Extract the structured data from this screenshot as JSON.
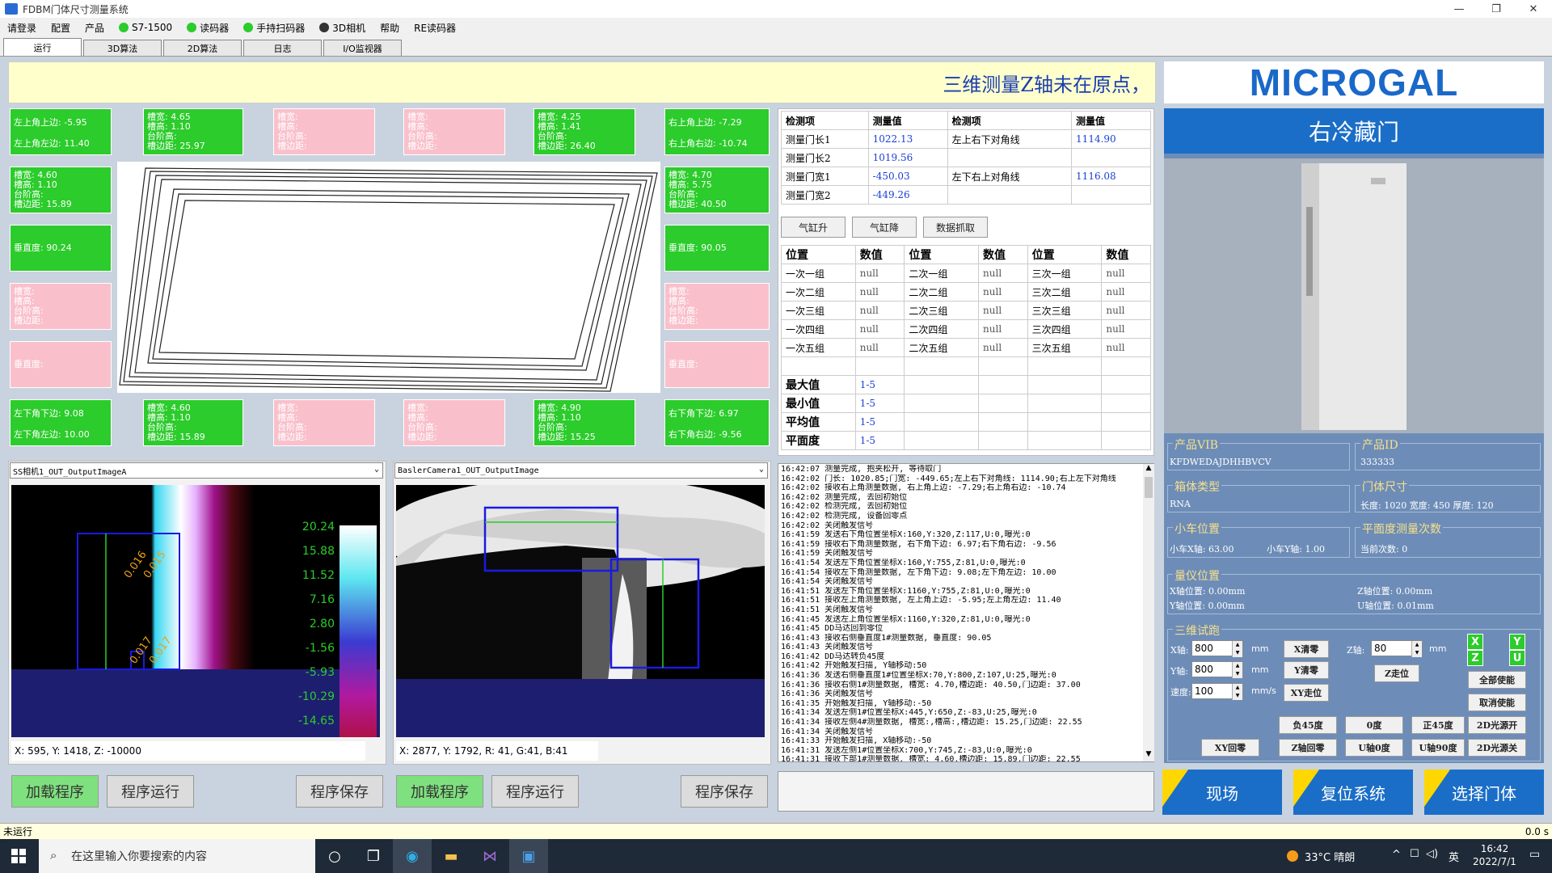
{
  "window": {
    "title": "FDBM门体尺寸测量系统",
    "min": "—",
    "max": "❐",
    "close": "✕"
  },
  "menu": [
    {
      "label": "请登录"
    },
    {
      "label": "配置"
    },
    {
      "label": "产品"
    },
    {
      "label": "S7-1500",
      "dot": "#2bcc2b"
    },
    {
      "label": "读码器",
      "dot": "#2bcc2b"
    },
    {
      "label": "手持扫码器",
      "dot": "#2bcc2b"
    },
    {
      "label": "3D相机",
      "dot": "#333333"
    },
    {
      "label": "帮助"
    },
    {
      "label": "RE读码器"
    }
  ],
  "tabs": [
    "运行",
    "3D算法",
    "2D算法",
    "日志",
    "I/O监视器"
  ],
  "banner": "三维测量Z轴未在原点，",
  "logo": "MICROGAL",
  "cards": {
    "tl": {
      "l1": "左上角上边: -5.95",
      "l2": "左上角左边: 11.40"
    },
    "tr": {
      "l1": "右上角上边: -7.29",
      "l2": "右上角右边: -10.74"
    },
    "bl": {
      "l1": "左下角下边: 9.08",
      "l2": "左下角左边: 10.00"
    },
    "br": {
      "l1": "右下角下边: 6.97",
      "l2": "右下角右边: -9.56"
    },
    "top1": [
      "槽宽: 4.65",
      "槽高: 1.10",
      "台阶高:",
      "槽边距: 25.97"
    ],
    "top2": [
      "槽宽:",
      "槽高:",
      "台阶高:",
      "槽边距:"
    ],
    "top3": [
      "槽宽:",
      "槽高:",
      "台阶高:",
      "槽边距:"
    ],
    "top4": [
      "槽宽: 4.25",
      "槽高: 1.41",
      "台阶高:",
      "槽边距: 26.40"
    ],
    "bot1": [
      "槽宽: 4.60",
      "槽高: 1.10",
      "台阶高:",
      "槽边距: 15.89"
    ],
    "bot2": [
      "槽宽:",
      "槽高:",
      "台阶高:",
      "槽边距:"
    ],
    "bot3": [
      "槽宽:",
      "槽高:",
      "台阶高:",
      "槽边距:"
    ],
    "bot4": [
      "槽宽: 4.90",
      "槽高: 1.10",
      "台阶高:",
      "槽边距: 15.25"
    ],
    "left1": [
      "槽宽: 4.60",
      "槽高: 1.10",
      "台阶高:",
      "槽边距: 15.89"
    ],
    "left2": "垂直度: 90.24",
    "left3": [
      "槽宽:",
      "槽高:",
      "台阶高:",
      "槽边距:"
    ],
    "left4": "垂直度:",
    "right1": [
      "槽宽: 4.70",
      "槽高: 5.75",
      "台阶高:",
      "槽边距: 40.50"
    ],
    "right2": "垂直度: 90.05",
    "right3": [
      "槽宽:",
      "槽高:",
      "台阶高:",
      "槽边距:"
    ],
    "right4": "垂直度:"
  },
  "cam1": {
    "combo": "SS相机1_OUT_OutputImageA",
    "status": "X: 595, Y: 1418, Z: -10000",
    "scale": [
      "20.24",
      "15.88",
      "11.52",
      "7.16",
      "2.80",
      "-1.56",
      "-5.93",
      "-10.29",
      "-14.65"
    ],
    "ann": [
      "0.016",
      "0.015",
      "0.017",
      "0.017"
    ]
  },
  "cam2": {
    "combo": "BaslerCamera1_OUT_OutputImage",
    "status": "X: 2877, Y: 1792, R: 41, G:41, B:41"
  },
  "bottom_buttons": [
    "加载程序",
    "程序运行",
    "程序保存",
    "加载程序",
    "程序运行",
    "程序保存"
  ],
  "measure": {
    "headers": [
      "检测项",
      "测量值",
      "检测项",
      "测量值"
    ],
    "rows": [
      [
        "测量门长1",
        "1022.13",
        "左上右下对角线",
        "1114.90"
      ],
      [
        "测量门长2",
        "1019.56",
        "",
        ""
      ],
      [
        "测量门宽1",
        "-450.03",
        "左下右上对角线",
        "1116.08"
      ],
      [
        "测量门宽2",
        "-449.26",
        "",
        ""
      ]
    ]
  },
  "actions": [
    "气缸升",
    "气缸降",
    "数据抓取"
  ],
  "positions": {
    "headers": [
      "位置",
      "数值",
      "位置",
      "数值",
      "位置",
      "数值"
    ],
    "rows": [
      [
        "一次一组",
        "null",
        "二次一组",
        "null",
        "三次一组",
        "null"
      ],
      [
        "一次二组",
        "null",
        "二次二组",
        "null",
        "三次二组",
        "null"
      ],
      [
        "一次三组",
        "null",
        "二次三组",
        "null",
        "三次三组",
        "null"
      ],
      [
        "一次四组",
        "null",
        "二次四组",
        "null",
        "三次四组",
        "null"
      ],
      [
        "一次五组",
        "null",
        "二次五组",
        "null",
        "三次五组",
        "null"
      ]
    ],
    "stats": [
      [
        "最大值",
        "1-5"
      ],
      [
        "最小值",
        "1-5"
      ],
      [
        "平均值",
        "1-5"
      ],
      [
        "平面度",
        "1-5"
      ]
    ]
  },
  "log": [
    "16:42:07 测量完成, 抱夹松开, 等待取门",
    "16:42:02 门长: 1020.85;门宽: -449.65;左上右下对角线: 1114.90;右上左下对角线",
    "16:42:02 接收右上角测量数据, 右上角上边: -7.29;右上角右边: -10.74",
    "16:42:02 测量完成, 去回初始位",
    "16:42:02 检测完成, 去回初始位",
    "16:42:02 检测完成, 设备回零点",
    "16:42:02 关闭触发信号",
    "16:41:59 发送右下角位置坐标X:160,Y:320,Z:117,U:0,曝光:0",
    "16:41:59 接收右下角测量数据, 右下角下边: 6.97;右下角右边: -9.56",
    "16:41:59 关闭触发信号",
    "16:41:54 发送左下角位置坐标X:160,Y:755,Z:81,U:0,曝光:0",
    "16:41:54 接收左下角测量数据, 左下角下边: 9.08;左下角左边: 10.00",
    "16:41:54 关闭触发信号",
    "16:41:51 发送左下角位置坐标X:1160,Y:755,Z:81,U:0,曝光:0",
    "16:41:51 接收左上角测量数据, 左上角上边: -5.95;左上角左边: 11.40",
    "16:41:51 关闭触发信号",
    "16:41:45 发送左上角位置坐标X:1160,Y:320,Z:81,U:0,曝光:0",
    "16:41:45 DD马达回到零位",
    "16:41:43 接收右侧垂直度1#测量数据, 垂直度: 90.05",
    "16:41:43 关闭触发信号",
    "16:41:42 DD马达转负45度",
    "16:41:42 开始触发扫描, Y轴移动:50",
    "16:41:36 发送右侧垂直度1#位置坐标X:70,Y:800,Z:107,U:25,曝光:0",
    "16:41:36 接收右侧1#测量数据, 槽宽: 4.70,槽边距: 40.50,门边距: 37.00",
    "16:41:36 关闭触发信号",
    "16:41:35 开始触发扫描, Y轴移动:-50",
    "16:41:34 发送左侧1#位置坐标X:445,Y:650,Z:-83,U:25,曝光:0",
    "16:41:34 接收左侧4#测量数据, 槽宽:,槽高:,槽边距: 15.25,门边距: 22.55",
    "16:41:34 关闭触发信号",
    "16:41:33 开始触发扫描, X轴移动:-50",
    "16:41:31 发送左侧1#位置坐标X:700,Y:745,Z:-83,U:0,曝光:0",
    "16:41:31 接收下部1#测量数据, 槽宽: 4.60,槽边距: 15.89,门边距: 22.55"
  ],
  "right": {
    "door_name": "右冷藏门",
    "vib_label": "产品VIB",
    "vib": "KFDWEDAJDHHBVCV",
    "id_label": "产品ID",
    "id": "333333",
    "box_label": "箱体类型",
    "box": "RNA",
    "size_label": "门体尺寸",
    "size": "长度: 1020 宽度: 450 厚度: 120",
    "cart_label": "小车位置",
    "cart_x": "小车X轴: 63.00",
    "cart_y": "小车Y轴: 1.00",
    "flat_label": "平面度测量次数",
    "flat": "当前次数: 0",
    "gauge_label": "量仪位置",
    "gx": "X轴位置: 0.00mm",
    "gz": "Z轴位置: 0.00mm",
    "gy": "Y轴位置: 0.00mm",
    "gu": "U轴位置: 0.01mm",
    "trial_label": "三维试跑",
    "x_label": "X轴:",
    "x_val": "800",
    "y_label": "Y轴:",
    "y_val": "800",
    "speed_label": "速度:",
    "speed_val": "100",
    "z_label": "Z轴:",
    "z_val": "80",
    "unit_mm": "mm",
    "unit_mms": "mm/s",
    "btn_xclear": "X清零",
    "btn_yclear": "Y清零",
    "btn_xyrun": "XY走位",
    "btn_zrun": "Z走位",
    "xyzu": [
      "X",
      "Y",
      "Z",
      "U"
    ],
    "btn_enable_all": "全部使能",
    "btn_disable": "取消使能",
    "angle_btns": [
      "负45度",
      "0度",
      "正45度",
      "2D光源开"
    ],
    "home_btns": [
      "XY回零",
      "Z轴回零",
      "U轴0度",
      "U轴90度",
      "2D光源关"
    ],
    "big": [
      "现场",
      "复位系统",
      "选择门体"
    ]
  },
  "statusbar": {
    "left": "未运行",
    "right": "0.0 s"
  },
  "taskbar": {
    "search": "在这里输入你要搜索的内容",
    "weather": "33°C 晴朗",
    "time": "16:42",
    "date": "2022/7/1",
    "ime": "英"
  }
}
